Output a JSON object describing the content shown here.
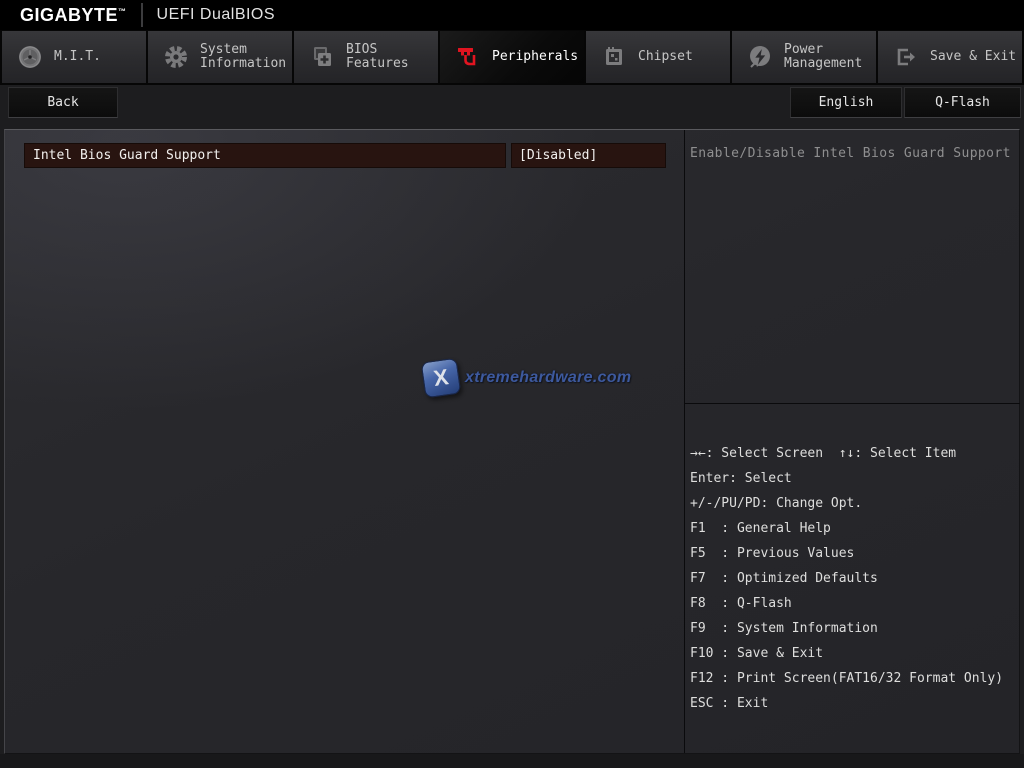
{
  "header": {
    "brand": "GIGABYTE",
    "trademark": "™",
    "title": "UEFI DualBIOS"
  },
  "tabs": [
    {
      "label": "M.I.T.",
      "icon": "mit-dial-icon",
      "selected": false
    },
    {
      "label": "System Information",
      "icon": "gear-icon",
      "selected": false
    },
    {
      "label": "BIOS Features",
      "icon": "folders-plus-icon",
      "selected": false
    },
    {
      "label": "Peripherals",
      "icon": "plug-icon",
      "selected": true
    },
    {
      "label": "Chipset",
      "icon": "chip-icon",
      "selected": false
    },
    {
      "label": "Power Management",
      "icon": "lightning-icon",
      "selected": false
    },
    {
      "label": "Save & Exit",
      "icon": "exit-arrow-icon",
      "selected": false
    }
  ],
  "toolbar": {
    "back_label": "Back",
    "language_label": "English",
    "qflash_label": "Q-Flash"
  },
  "main": {
    "option_label": "Intel Bios Guard Support",
    "option_value": "[Disabled]"
  },
  "help": {
    "text": "Enable/Disable Intel Bios Guard Support"
  },
  "shortcuts": [
    "→←: Select Screen  ↑↓: Select Item",
    "Enter: Select",
    "+/-/PU/PD: Change Opt.",
    "F1  : General Help",
    "F5  : Previous Values",
    "F7  : Optimized Defaults",
    "F8  : Q-Flash",
    "F9  : System Information",
    "F10 : Save & Exit",
    "F12 : Print Screen(FAT16/32 Format Only)",
    "ESC : Exit"
  ],
  "watermark": {
    "badge_letter": "X",
    "text": "xtremehardware.com"
  },
  "colors": {
    "accent_red": "#e11420",
    "highlight_bg": "#281410",
    "panel_bg": "#27272b",
    "watermark_blue": "#3f5ea8"
  }
}
